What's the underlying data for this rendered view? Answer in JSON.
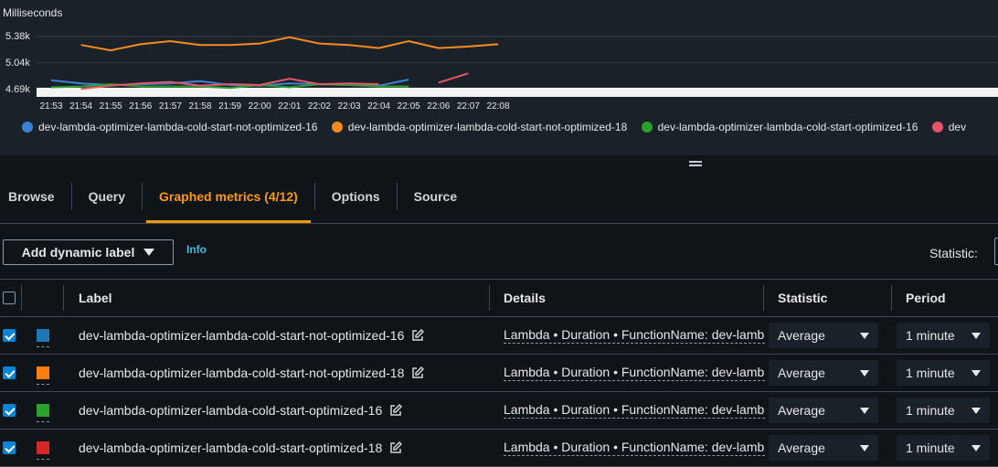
{
  "chart": {
    "y_title": "Milliseconds",
    "y_ticks": [
      "5.38k",
      "5.04k",
      "4.69k"
    ],
    "x_ticks": [
      "21:53",
      "21:54",
      "21:55",
      "21:56",
      "21:57",
      "21:58",
      "21:59",
      "22:00",
      "22:01",
      "22:02",
      "22:03",
      "22:04",
      "22:05",
      "22:06",
      "22:07",
      "22:08"
    ],
    "legend": [
      {
        "label": "dev-lambda-optimizer-lambda-cold-start-not-optimized-16",
        "color": "#3b82d6"
      },
      {
        "label": "dev-lambda-optimizer-lambda-cold-start-not-optimized-18",
        "color": "#f58a1f"
      },
      {
        "label": "dev-lambda-optimizer-lambda-cold-start-optimized-16",
        "color": "#2ca02c"
      },
      {
        "label": "dev",
        "color": "#e5556a"
      }
    ]
  },
  "chart_data": {
    "type": "line",
    "ylabel": "Milliseconds",
    "ylim": [
      4650,
      5450
    ],
    "y_tick_values": [
      5380,
      5040,
      4690
    ],
    "x": [
      "21:53",
      "21:54",
      "21:55",
      "21:56",
      "21:57",
      "21:58",
      "21:59",
      "22:00",
      "22:01",
      "22:02",
      "22:03",
      "22:04",
      "22:05",
      "22:06",
      "22:07",
      "22:08"
    ],
    "series": [
      {
        "name": "dev-lambda-optimizer-lambda-cold-start-not-optimized-16",
        "color": "#3b82d6",
        "values": [
          4810,
          4770,
          4750,
          4760,
          4770,
          4800,
          4750,
          4740,
          4770,
          4760,
          4750,
          4740,
          4820,
          null,
          null,
          null
        ]
      },
      {
        "name": "dev-lambda-optimizer-lambda-cold-start-not-optimized-18",
        "color": "#f58a1f",
        "values": [
          null,
          5270,
          5200,
          5280,
          5320,
          5270,
          5270,
          5290,
          5370,
          5290,
          5270,
          5230,
          5320,
          5230,
          5250,
          5280
        ]
      },
      {
        "name": "dev-lambda-optimizer-lambda-cold-start-optimized-16",
        "color": "#2ca02c",
        "values": [
          4720,
          4730,
          4760,
          4730,
          4730,
          4730,
          4710,
          4750,
          4720,
          4760,
          4750,
          4730,
          4730,
          null,
          null,
          null
        ]
      },
      {
        "name": "dev",
        "color": "#e5556a",
        "values": [
          null,
          4700,
          4740,
          4770,
          4790,
          4740,
          4760,
          4750,
          4830,
          4760,
          4770,
          4760,
          null,
          4780,
          4900,
          null
        ]
      }
    ]
  },
  "tabs": [
    {
      "label": "Browse",
      "active": false
    },
    {
      "label": "Query",
      "active": false
    },
    {
      "label": "Graphed metrics (4/12)",
      "active": true
    },
    {
      "label": "Options",
      "active": false
    },
    {
      "label": "Source",
      "active": false
    }
  ],
  "toolbar": {
    "dynamic_label_button": "Add dynamic label",
    "info_link": "Info",
    "statistic_label": "Statistic:"
  },
  "table": {
    "headers": {
      "label": "Label",
      "details": "Details",
      "statistic": "Statistic",
      "period": "Period"
    },
    "rows": [
      {
        "checked": true,
        "color": "#1f77b4",
        "label": "dev-lambda-optimizer-lambda-cold-start-not-optimized-16",
        "details": "Lambda • Duration • FunctionName: dev-lamb",
        "statistic": "Average",
        "period": "1 minute"
      },
      {
        "checked": true,
        "color": "#ff7f0e",
        "label": "dev-lambda-optimizer-lambda-cold-start-not-optimized-18",
        "details": "Lambda • Duration • FunctionName: dev-lamb",
        "statistic": "Average",
        "period": "1 minute"
      },
      {
        "checked": true,
        "color": "#2ca02c",
        "label": "dev-lambda-optimizer-lambda-cold-start-optimized-16",
        "details": "Lambda • Duration • FunctionName: dev-lamb",
        "statistic": "Average",
        "period": "1 minute"
      },
      {
        "checked": true,
        "color": "#d62728",
        "label": "dev-lambda-optimizer-lambda-cold-start-optimized-18",
        "details": "Lambda • Duration • FunctionName: dev-lamb",
        "statistic": "Average",
        "period": "1 minute"
      }
    ]
  }
}
